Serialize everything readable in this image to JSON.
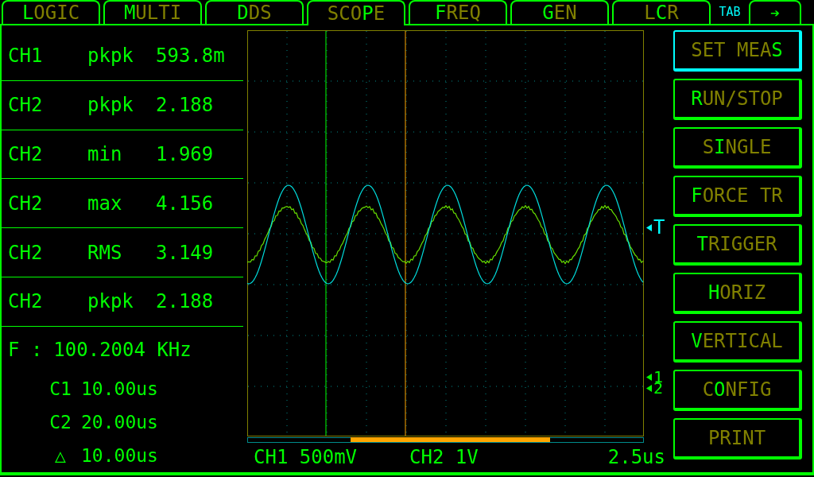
{
  "tabs": [
    {
      "key": "L",
      "post": "OGIC",
      "selected": false
    },
    {
      "key": "M",
      "post": "ULTI",
      "selected": false
    },
    {
      "key": "D",
      "post": "DS",
      "selected": false
    },
    {
      "pre": "SCO",
      "key": "P",
      "post": "E",
      "selected": true
    },
    {
      "key": "F",
      "post": "REQ",
      "selected": false
    },
    {
      "key": "G",
      "post": "EN",
      "selected": false
    },
    {
      "pre": "L",
      "key": "C",
      "post": "R",
      "selected": false
    }
  ],
  "tab_key": "TAB",
  "next_tab": "➔",
  "measurements": [
    {
      "channel": "CH1",
      "type": "pkpk",
      "value": "593.8m"
    },
    {
      "channel": "CH2",
      "type": "pkpk",
      "value": "2.188"
    },
    {
      "channel": "CH2",
      "type": "min",
      "value": "1.969"
    },
    {
      "channel": "CH2",
      "type": "max",
      "value": "4.156"
    },
    {
      "channel": "CH2",
      "type": "RMS",
      "value": "3.149"
    },
    {
      "channel": "CH2",
      "type": "pkpk",
      "value": "2.188"
    }
  ],
  "frequency": {
    "label": "F :",
    "value": "100.2004 KHz"
  },
  "cursors": [
    {
      "label": "C1",
      "value": "10.00us"
    },
    {
      "label": "C2",
      "value": "20.00us"
    },
    {
      "label": "△",
      "value": "10.00us"
    }
  ],
  "markers": [
    {
      "label": "T",
      "color": "#00ffff"
    },
    {
      "label": "1",
      "color": "#00ff00"
    },
    {
      "label": "2",
      "color": "#00ff00"
    }
  ],
  "status": {
    "ch1": "CH1 500mV",
    "ch2": "CH2 1V",
    "timebase": "2.5us"
  },
  "buttons": [
    {
      "pre": "SET MEA",
      "key": "S",
      "selected": true
    },
    {
      "key": "R",
      "post": "UN/STOP",
      "selected": false
    },
    {
      "pre": "S",
      "key": "I",
      "post": "NGLE",
      "selected": false
    },
    {
      "key": "F",
      "post": "ORCE TR",
      "selected": false
    },
    {
      "key": "T",
      "post": "RIGGER",
      "selected": false
    },
    {
      "key": "H",
      "post": "ORIZ",
      "selected": false
    },
    {
      "key": "V",
      "post": "ERTICAL",
      "selected": false
    },
    {
      "pre": "C",
      "key": "O",
      "post": "NFIG",
      "selected": false
    },
    {
      "pre": "PRINT",
      "selected": false
    }
  ]
}
